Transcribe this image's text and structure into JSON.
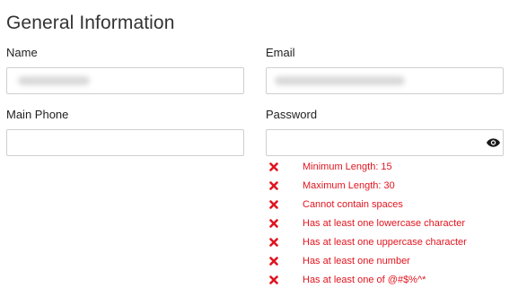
{
  "section": {
    "title": "General Information"
  },
  "fields": {
    "name": {
      "label": "Name",
      "value": ""
    },
    "email": {
      "label": "Email",
      "value": ""
    },
    "main_phone": {
      "label": "Main Phone",
      "value": ""
    },
    "password": {
      "label": "Password",
      "value": "",
      "reveal_icon": "eye-icon"
    }
  },
  "password_rules": {
    "status_icon": "x-icon",
    "color": "#e0151f",
    "items": [
      {
        "label": "Minimum Length: 15",
        "met": false
      },
      {
        "label": "Maximum Length: 30",
        "met": false
      },
      {
        "label": "Cannot contain spaces",
        "met": false
      },
      {
        "label": "Has at least one lowercase character",
        "met": false
      },
      {
        "label": "Has at least one uppercase character",
        "met": false
      },
      {
        "label": "Has at least one number",
        "met": false
      },
      {
        "label": "Has at least one of @#$%^*",
        "met": false
      }
    ]
  }
}
